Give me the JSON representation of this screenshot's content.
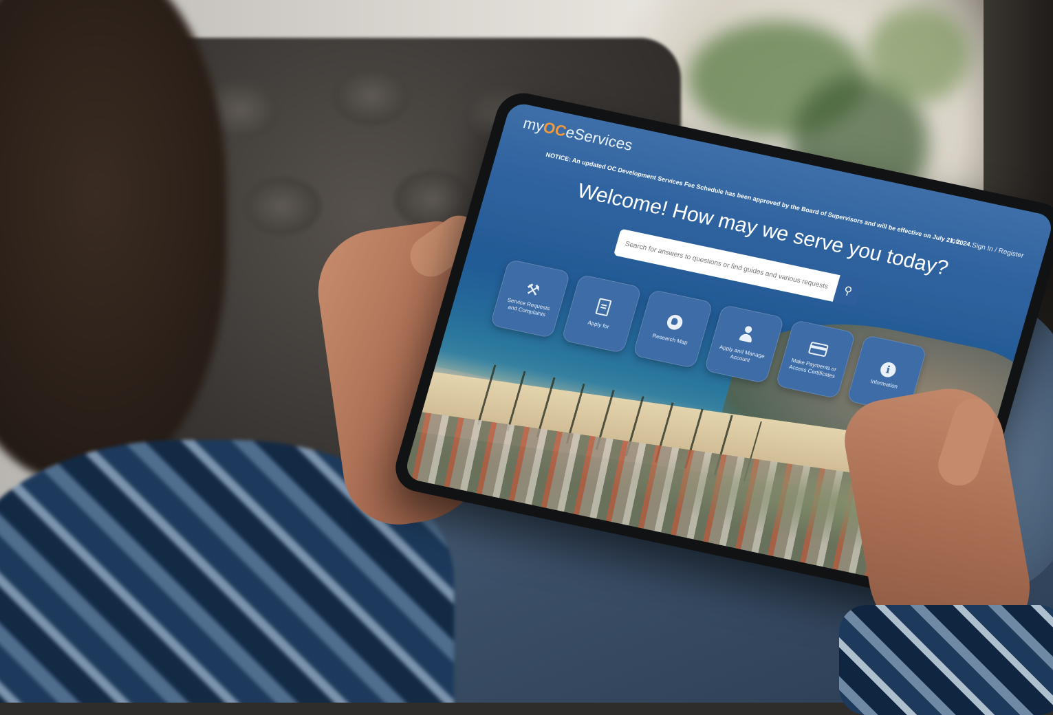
{
  "brand": {
    "prefix": "my",
    "highlight": "OC",
    "suffix": "eServices"
  },
  "top_nav": {
    "info": "Info",
    "sign_in": "Sign In / Register"
  },
  "notice": "NOTICE: An updated OC Development Services Fee Schedule has been approved by the Board of Supervisors and will be effective on July 21, 2024.",
  "welcome_heading": "Welcome! How may we serve you today?",
  "search": {
    "placeholder": "Search for answers to questions or find guides and various requests"
  },
  "tiles": [
    {
      "icon": "tools-icon",
      "label": "Service Requests and Complaints"
    },
    {
      "icon": "document-icon",
      "label": "Apply for"
    },
    {
      "icon": "globe-icon",
      "label": "Research Map"
    },
    {
      "icon": "person-icon",
      "label": "Apply and Manage Account"
    },
    {
      "icon": "credit-card-icon",
      "label": "Make Payments or Access Certificates"
    },
    {
      "icon": "info-icon",
      "label": "Information"
    }
  ],
  "colors": {
    "tile": "#3d6ca6",
    "brand_highlight": "#f29a3b",
    "search_button": "#2e5f9c"
  }
}
